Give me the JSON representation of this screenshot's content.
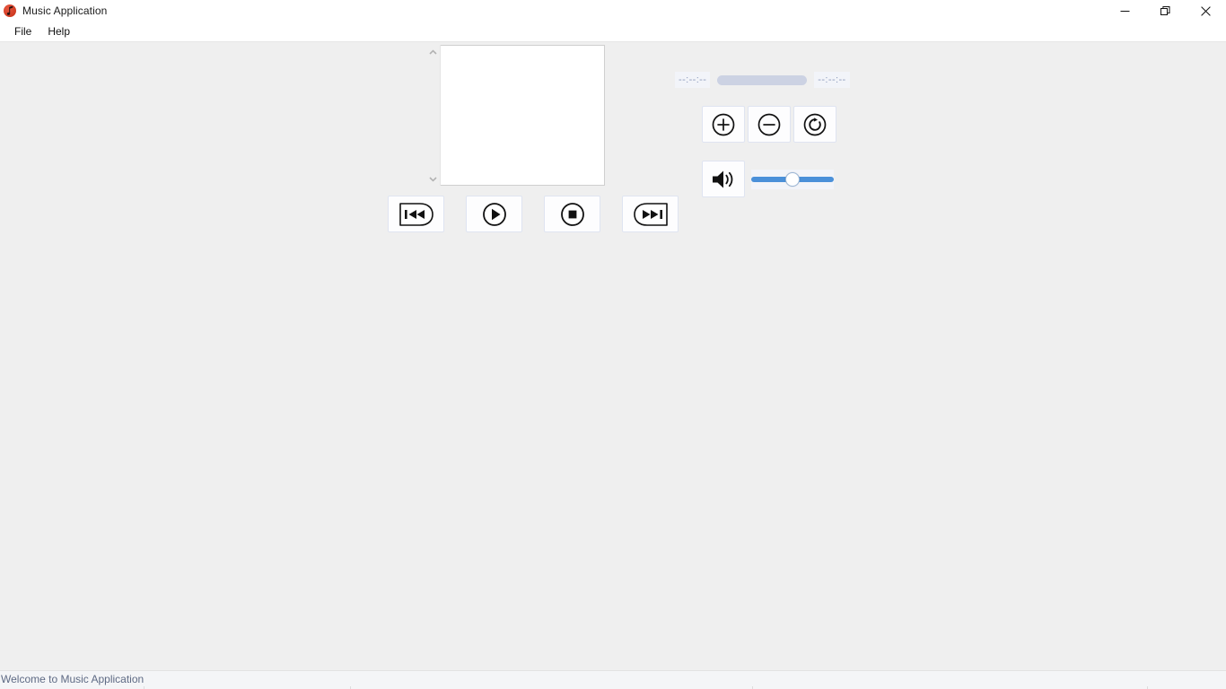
{
  "window": {
    "title": "Music Application",
    "icon": "music-note-icon",
    "controls": {
      "minimize": "minimize-icon",
      "restore": "restore-icon",
      "close": "close-icon"
    }
  },
  "menubar": {
    "items": [
      {
        "label": "File",
        "name": "menu-file"
      },
      {
        "label": "Help",
        "name": "menu-help"
      }
    ]
  },
  "display": {
    "scrollbar": {
      "up": "chevron-up-icon",
      "down": "chevron-down-icon"
    }
  },
  "transport": {
    "buttons": [
      {
        "name": "rewind-button",
        "icon": "rewind-icon"
      },
      {
        "name": "play-button",
        "icon": "play-icon"
      },
      {
        "name": "stop-button",
        "icon": "stop-icon"
      },
      {
        "name": "forward-button",
        "icon": "fast-forward-icon"
      }
    ]
  },
  "player": {
    "elapsed_time": "--:--:--",
    "total_time": "--:--:--",
    "progress_percent": 0,
    "zoom_in": "zoom-in-icon",
    "zoom_out": "zoom-out-icon",
    "reset": "rotate-reset-icon",
    "volume_icon": "speaker-icon",
    "volume_percent": 50
  },
  "statusbar": {
    "message": "Welcome to Music Application"
  },
  "colors": {
    "accent": "#4a90d9",
    "track": "#ccd2e3",
    "time_text": "#8e9bbd",
    "window_bg": "#efefef",
    "status_text": "#5e6a84",
    "app_icon": "#cf3b22"
  }
}
